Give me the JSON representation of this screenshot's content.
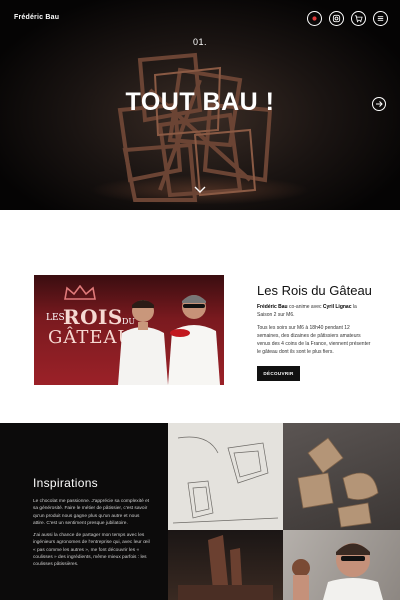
{
  "header": {
    "brand": "Frédéric Bau",
    "icons": [
      "record-icon",
      "instagram-icon",
      "cart-icon",
      "menu-icon"
    ]
  },
  "hero": {
    "slide_number": "01.",
    "title": "TOUT BAU !"
  },
  "show": {
    "image_logo": {
      "les": "LES",
      "rois": "ROIS",
      "du": "DU",
      "gateau": "GÂTEAU"
    },
    "title": "Les Rois du Gâteau",
    "paragraph1": {
      "name1": "Frédéric Bau",
      "text1": " co-anime avec ",
      "name2": "Cyril Lignac",
      "text2": " la Saison 2 sur M6."
    },
    "paragraph2": "Tous les soirs sur M6 à 18h40 pendant 12 semaines, des dizaines de pâtissiers amateurs venus des 4 coins de la France, viennent présenter le gâteau dont ils sont le plus fiers.",
    "button_label": "DÉCOUVRIR"
  },
  "inspirations": {
    "title": "Inspirations",
    "paragraph1": "Le chocolat me passionne. J'apprécie sa complexité et sa générosité. Faire le métier de pâtissier, c'est savoir qu'un produit nous gagne plus qu'un autre et nous attire. C'est un sentiment presque jubilatoire.",
    "paragraph2": "J'ai aussi la chance de partager mon temps avec les ingénieurs agronomes de l'entreprise qui, avec leur œil « pas comme les autres », me font découvrir les « coulisses » des ingrédients, même mieux parfois : les coulisses pâtissières."
  },
  "colors": {
    "hero_bg": "#050404",
    "show_red": "#9b2128",
    "button_bg": "#111111",
    "inspirations_bg": "#0c0b0b"
  }
}
